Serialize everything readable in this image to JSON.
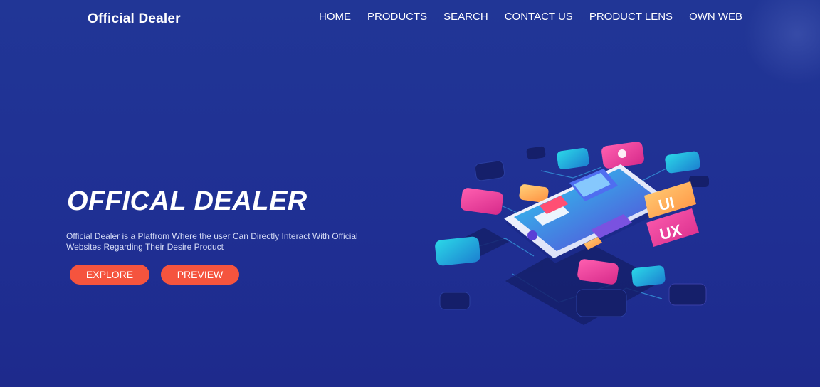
{
  "header": {
    "brand": "Official Dealer",
    "nav": [
      {
        "label": "HOME"
      },
      {
        "label": "PRODUCTS"
      },
      {
        "label": "SEARCH"
      },
      {
        "label": "CONTACT US"
      },
      {
        "label": "PRODUCT LENS"
      },
      {
        "label": "OWN WEB"
      }
    ]
  },
  "hero": {
    "title": "OFFICAL DEALER",
    "description": "Official Dealer is a Platfrom Where the user Can Directly Interact With Official Websites Regarding Their Desire Product",
    "buttons": {
      "explore": "EXPLORE",
      "preview": "PREVIEW"
    }
  },
  "illustration": {
    "tiles": [
      "UI",
      "UX"
    ]
  },
  "colors": {
    "background": "#1f2f93",
    "button": "#f5543e",
    "text": "#ffffff"
  }
}
